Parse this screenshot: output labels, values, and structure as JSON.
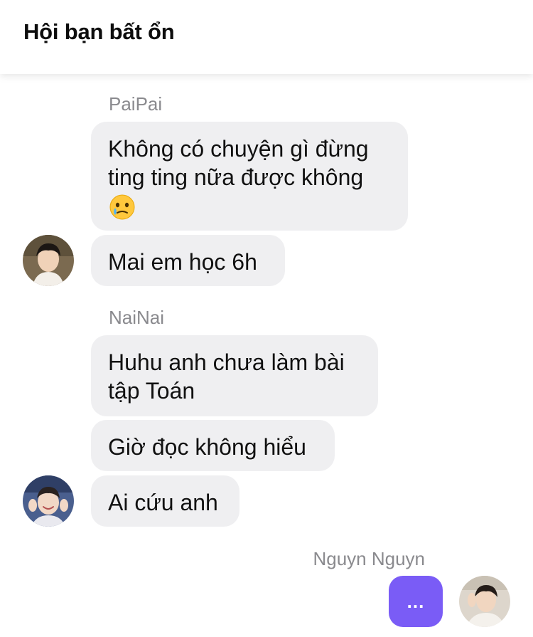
{
  "header": {
    "title": "Hội bạn bất ổn"
  },
  "colors": {
    "accent": "#7a5cf6",
    "bubble": "#efeff1",
    "sender_text": "#8a8a8e"
  },
  "groups": [
    {
      "sender": "PaiPai",
      "messages": [
        {
          "text": "Không có chuyện gì đừng ting ting nữa được không",
          "emoji": "face-holding-back-tears-icon"
        },
        {
          "text": "Mai em học 6h"
        }
      ]
    },
    {
      "sender": "NaiNai",
      "messages": [
        {
          "text": "Huhu anh chưa làm bài tập Toán"
        },
        {
          "text": "Giờ đọc không hiểu"
        },
        {
          "text": "Ai cứu anh"
        }
      ]
    },
    {
      "sender": "Nguyn Nguyn",
      "typing_indicator": "..."
    }
  ]
}
